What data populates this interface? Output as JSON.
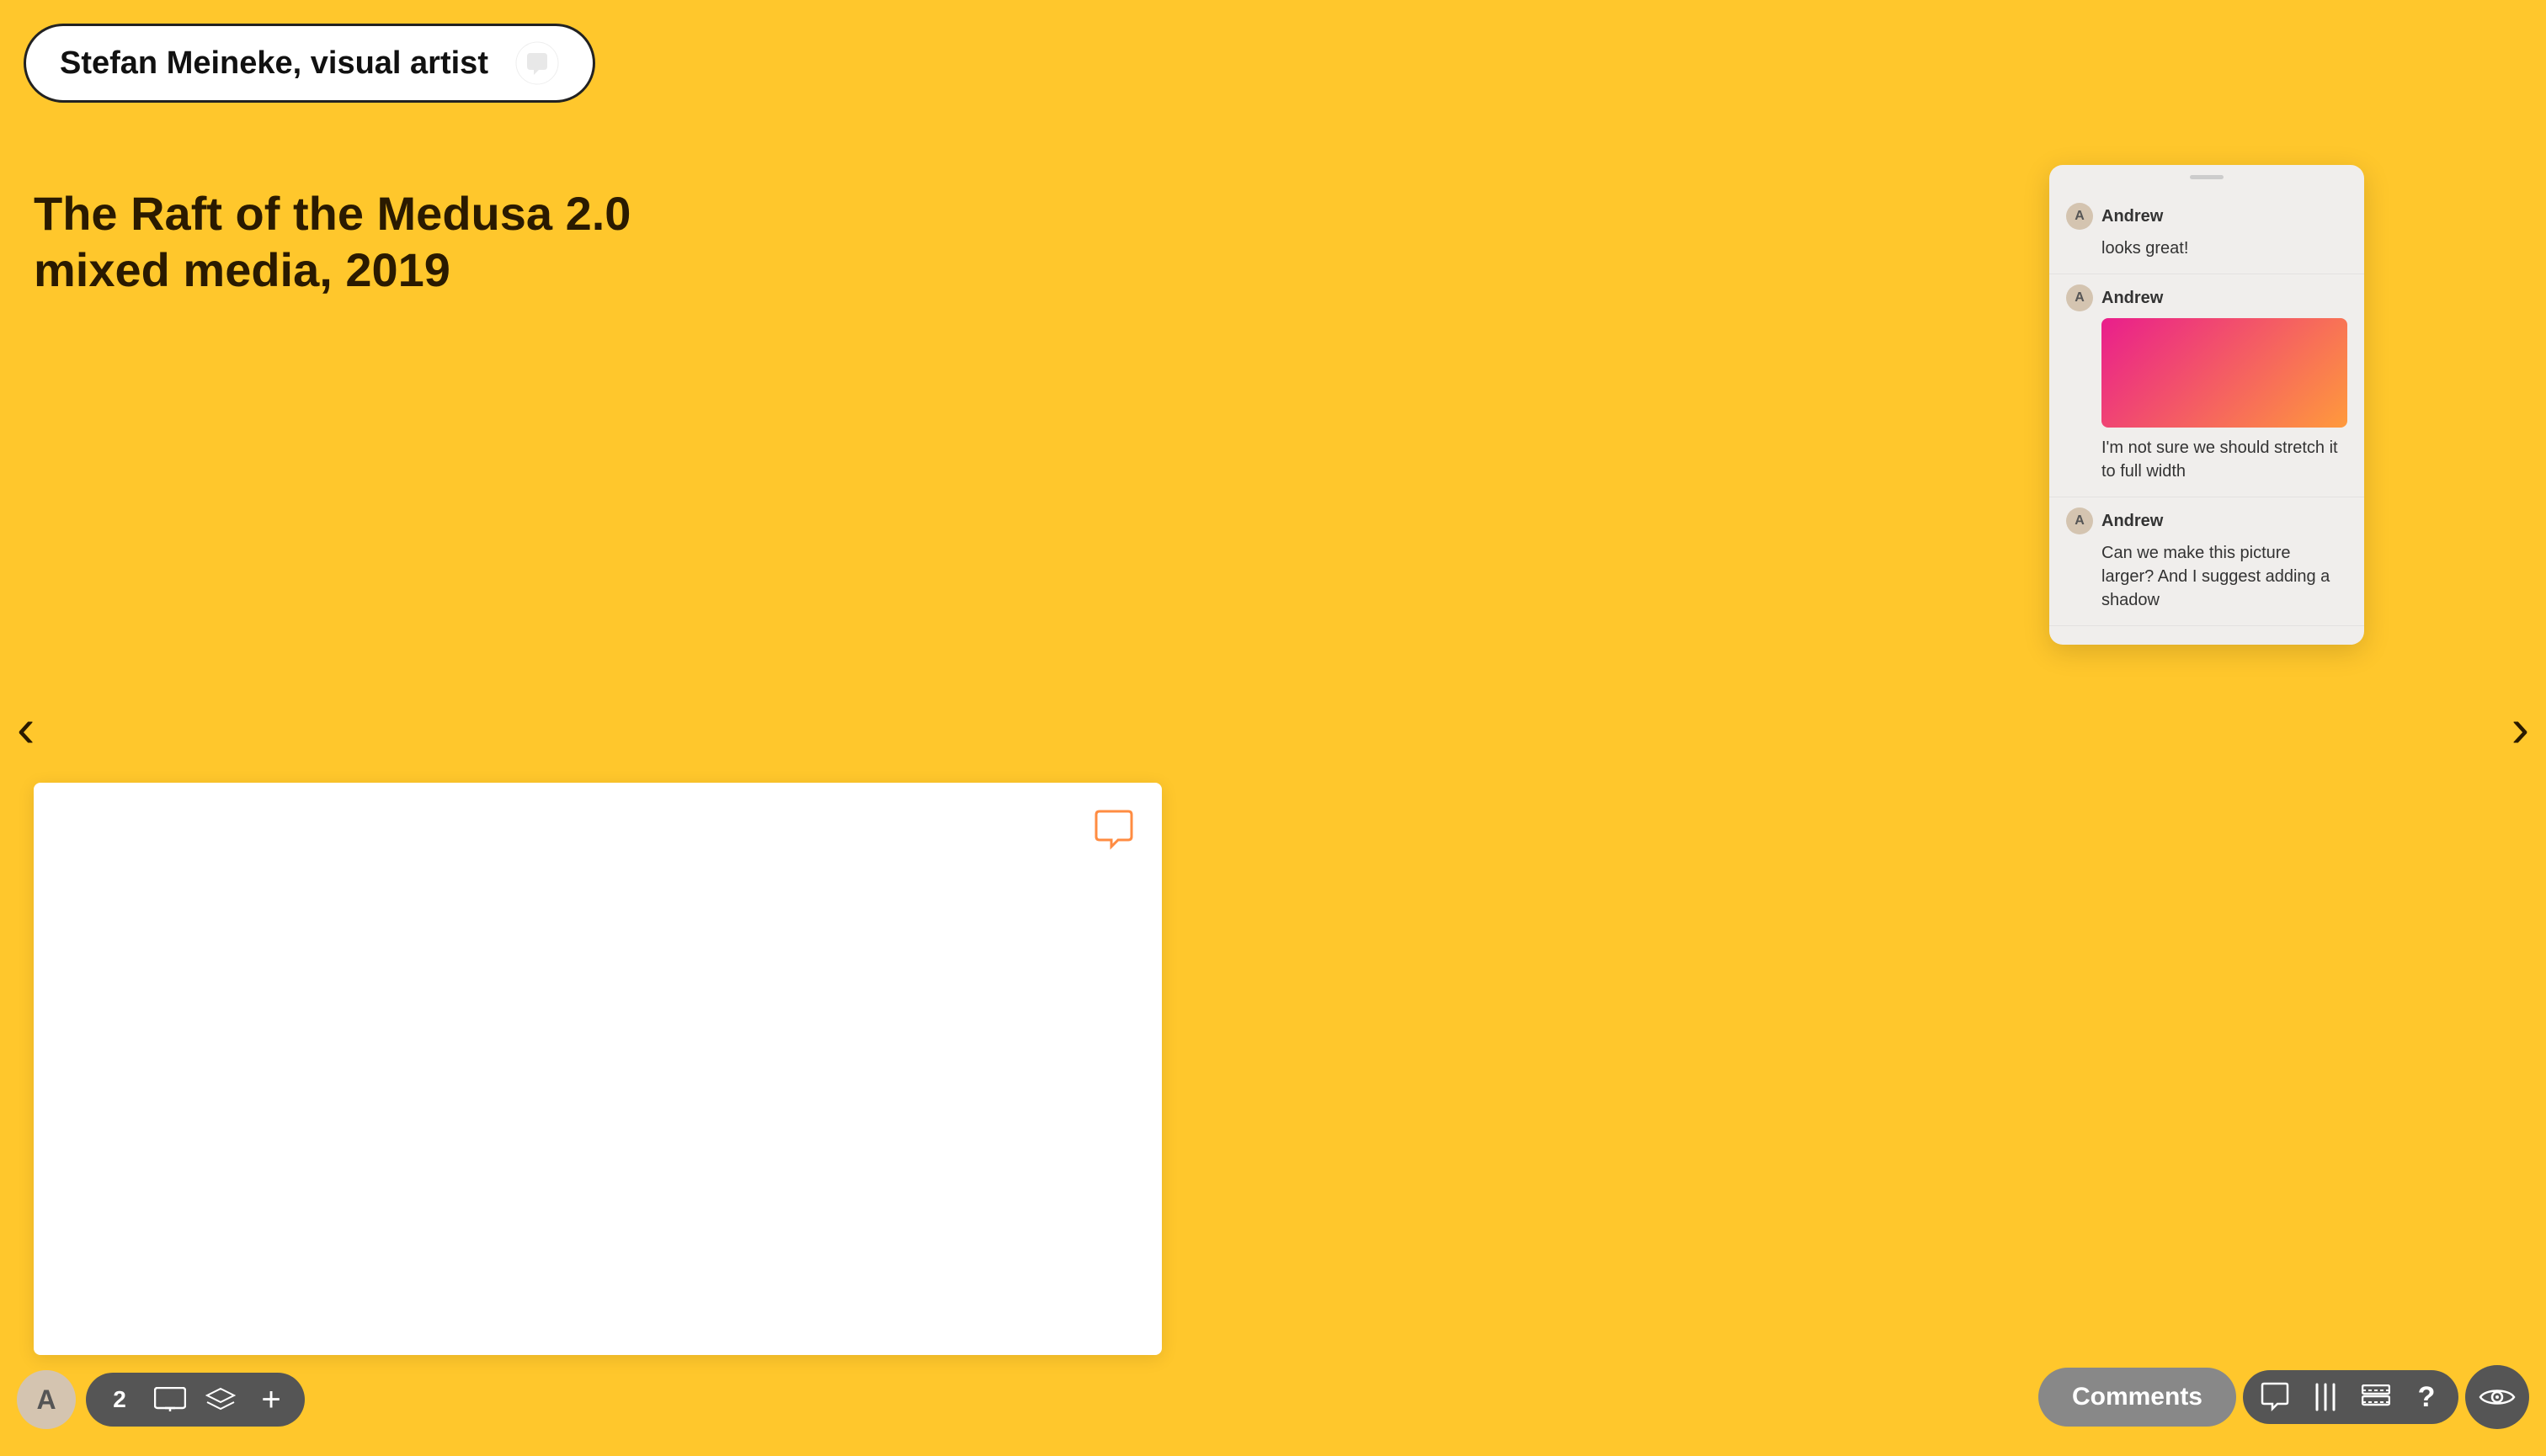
{
  "artist": {
    "name": "Stefan Meineke, visual artist"
  },
  "artwork": {
    "title_line1": "The Raft of the Medusa 2.0",
    "title_line2": "mixed media, 2019"
  },
  "nav": {
    "left_arrow": "‹",
    "right_arrow": "›"
  },
  "comments_panel": {
    "drag_handle": true,
    "comments": [
      {
        "id": 1,
        "author": "Andrew",
        "avatar_letter": "A",
        "text": "looks great!",
        "has_image": false
      },
      {
        "id": 2,
        "author": "Andrew",
        "avatar_letter": "A",
        "text": "I'm not sure we should stretch it to full width",
        "has_image": true
      },
      {
        "id": 3,
        "author": "Andrew",
        "avatar_letter": "A",
        "text": "Can we make this picture larger? And I suggest adding a shadow",
        "has_image": false
      }
    ]
  },
  "toolbar": {
    "user_avatar_letter": "A",
    "layer_icon": "2",
    "monitor_icon": "⬜",
    "layers_icon": "◈",
    "add_icon": "+",
    "comments_label": "Comments",
    "chat_icon": "💬",
    "columns_icon": "|||",
    "settings_icon": "⚙",
    "help_icon": "?",
    "eye_icon": "👁"
  },
  "colors": {
    "background": "#FFC72C",
    "panel_bg": "#f0eeec",
    "toolbar_bg": "#555555",
    "comments_btn_bg": "#888888",
    "text_dark": "#2a1a00",
    "accent_orange": "#FF8C42",
    "image_gradient_start": "#e91e8c",
    "image_gradient_end": "#ff6b35"
  }
}
